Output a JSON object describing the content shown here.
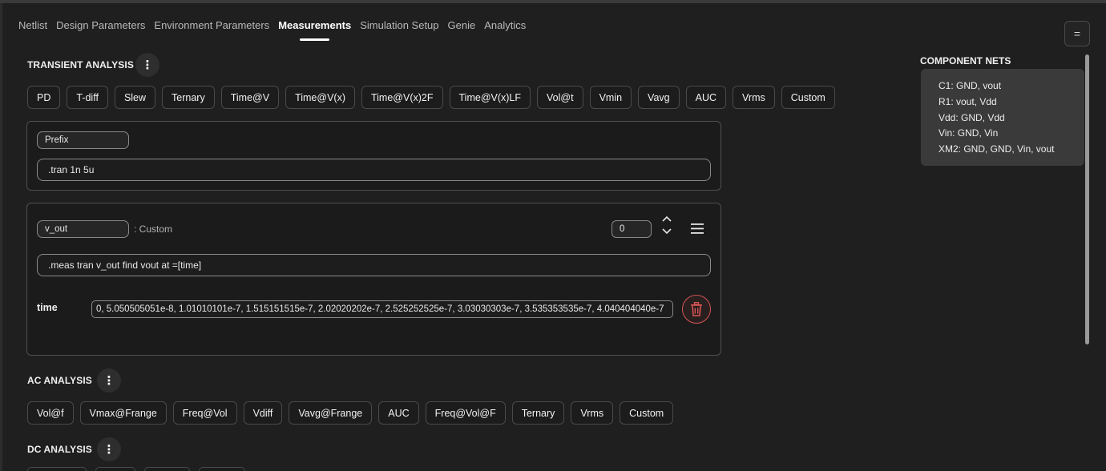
{
  "tabs": [
    {
      "label": "Netlist"
    },
    {
      "label": "Design Parameters"
    },
    {
      "label": "Environment Parameters"
    },
    {
      "label": "Measurements"
    },
    {
      "label": "Simulation Setup"
    },
    {
      "label": "Genie"
    },
    {
      "label": "Analytics"
    }
  ],
  "active_tab": "Measurements",
  "menu_button": {
    "glyph": "="
  },
  "transient": {
    "title": "TRANSIENT ANALYSIS",
    "kebab": "⋮",
    "buttons": [
      "PD",
      "T-diff",
      "Slew",
      "Ternary",
      "Time@V",
      "Time@V(x)",
      "Time@V(x)2F",
      "Time@V(x)LF",
      "Vol@t",
      "Vmin",
      "Vavg",
      "AUC",
      "Vrms",
      "Custom"
    ]
  },
  "prefix_card": {
    "name_value": "Prefix",
    "command_value": ".tran 1n 5u"
  },
  "measure_card": {
    "name_value": "v_out",
    "type_label": ": Custom",
    "index_value": "0",
    "command_value": ".meas tran v_out find vout at =[time]",
    "param_label": "time",
    "param_value": "0, 5.050505051e-8, 1.01010101e-7, 1.515151515e-7, 2.02020202e-7, 2.525252525e-7, 3.03030303e-7, 3.535353535e-7, 4.040404040e-7"
  },
  "ac": {
    "title": "AC ANALYSIS",
    "kebab": "⋮",
    "buttons": [
      "Vol@f",
      "Vmax@Frange",
      "Freq@Vol",
      "Vdiff",
      "Vavg@Frange",
      "AUC",
      "Freq@Vol@F",
      "Ternary",
      "Vrms",
      "Custom"
    ]
  },
  "dc": {
    "title": "DC ANALYSIS",
    "kebab": "⋮"
  },
  "component_nets": {
    "title": "COMPONENT NETS",
    "lines": [
      "C1: GND, vout",
      "R1: vout, Vdd",
      "Vdd: GND, Vdd",
      "Vin: GND, Vin",
      "XM2: GND, GND, Vin, vout"
    ]
  },
  "colors": {
    "background": "#1f1f1f",
    "chip_border": "#4a4a4a",
    "delete_accent": "#d65555",
    "nets_panel": "#3a3a3a"
  }
}
